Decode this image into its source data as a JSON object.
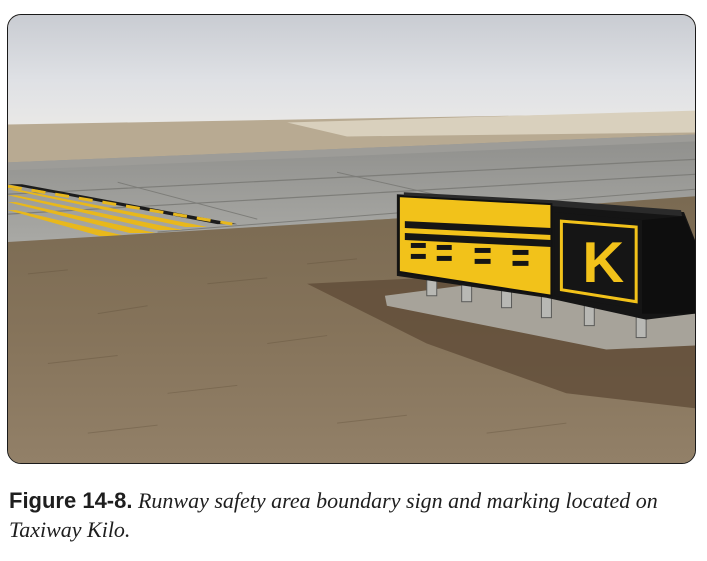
{
  "figure": {
    "label": "Figure 14-8.",
    "caption": "Runway safety area boundary sign and marking located on Taxiway Kilo.",
    "sign_letter": "K",
    "colors": {
      "sign_yellow": "#f2c21a",
      "sign_black": "#151515",
      "grass": "#7c6a4e",
      "pavement": "#a8a8a2",
      "sky": "#dfe2e6"
    }
  }
}
